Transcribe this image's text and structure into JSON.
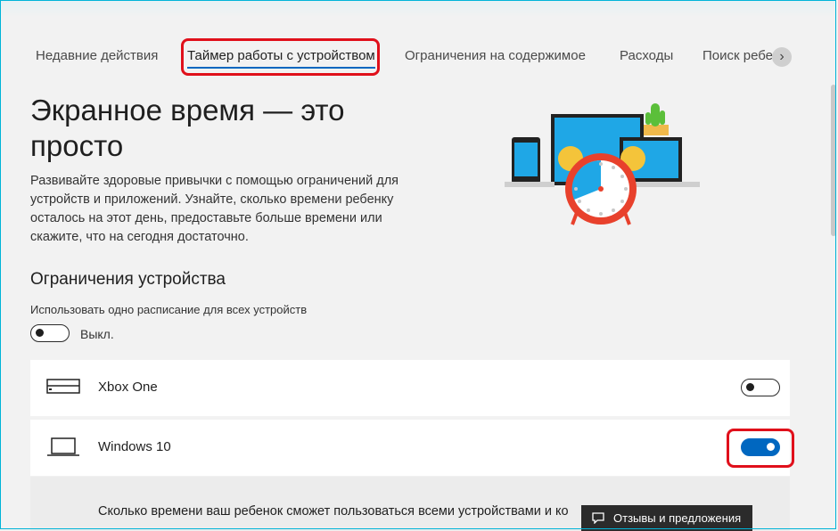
{
  "tabs": [
    {
      "label": "Недавние действия",
      "active": false
    },
    {
      "label": "Таймер работы с устройством",
      "active": true
    },
    {
      "label": "Ограничения на содержимое",
      "active": false
    },
    {
      "label": "Расходы",
      "active": false
    },
    {
      "label": "Поиск ребе",
      "active": false
    }
  ],
  "tabs_next_icon": "chevron-right-icon",
  "hero": {
    "title": "Экранное время — это просто",
    "description": "Развивайте здоровые привычки с помощью ограничений для устройств и приложений. Узнайте, сколько времени ребенку осталось на этот день, предоставьте больше времени или скажите, что на сегодня достаточно."
  },
  "device_limits": {
    "title": "Ограничения устройства",
    "schedule_label": "Использовать одно расписание для всех устройств",
    "schedule_toggle_state": "Выкл.",
    "schedule_toggle_on": false
  },
  "devices": [
    {
      "name": "Xbox One",
      "icon": "xbox-console-icon",
      "enabled": false
    },
    {
      "name": "Windows 10",
      "icon": "laptop-icon",
      "enabled": true
    }
  ],
  "expanded_text": "Сколько времени ваш ребенок сможет пользоваться всеми устройствами и ко",
  "feedback": {
    "label": "Отзывы и предложения",
    "icon": "feedback-icon"
  },
  "colors": {
    "accent": "#0067c0",
    "highlight": "#e0101b",
    "illustration_screen": "#1fa7e6",
    "clock_red": "#e8412c"
  }
}
